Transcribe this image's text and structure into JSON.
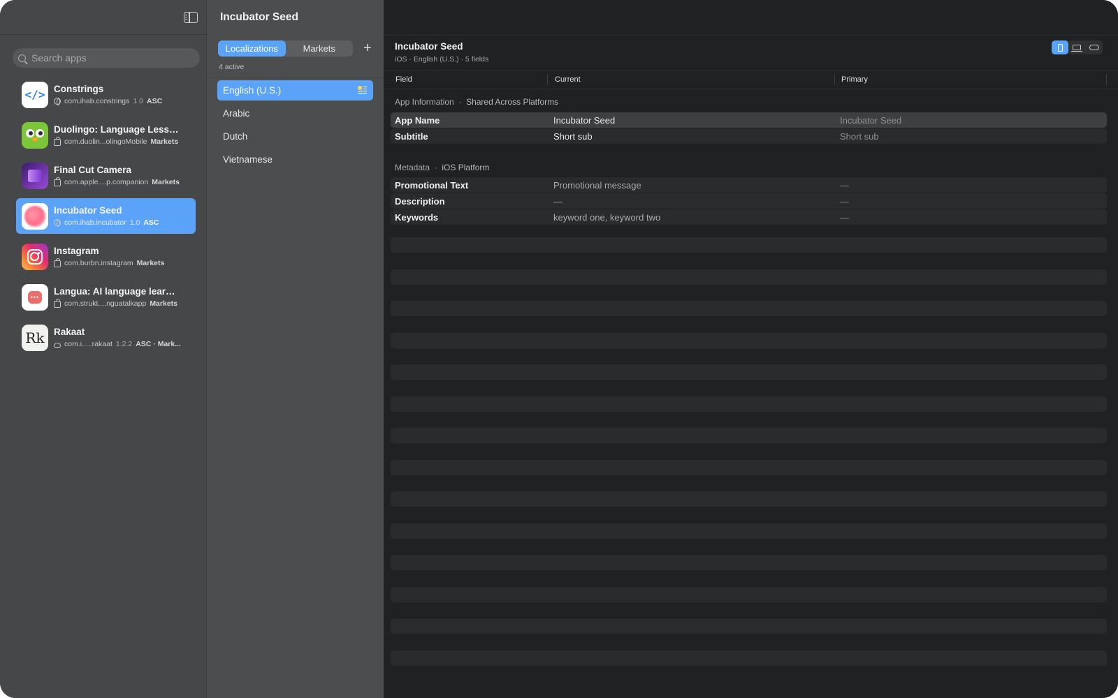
{
  "sidebar": {
    "search_placeholder": "Search apps",
    "apps": [
      {
        "name": "Constrings",
        "bundle": "com.ihab.constrings",
        "version": "1.0",
        "tag": "ASC",
        "meta_icon": "globe-icon",
        "app_icon": "code-brackets-icon"
      },
      {
        "name": "Duolingo: Language Lesso...",
        "bundle": "com.duolin...olingoMobile",
        "version": "",
        "tag": "Markets",
        "meta_icon": "bag-icon",
        "app_icon": "owl-icon"
      },
      {
        "name": "Final Cut Camera",
        "bundle": "com.apple....p.companion",
        "version": "",
        "tag": "Markets",
        "meta_icon": "bag-icon",
        "app_icon": "film-icon"
      },
      {
        "name": "Incubator Seed",
        "bundle": "com.ihab.incubator",
        "version": "1.0",
        "tag": "ASC",
        "meta_icon": "globe-icon",
        "app_icon": "gradient-blob-icon"
      },
      {
        "name": "Instagram",
        "bundle": "com.burbn.instagram",
        "version": "",
        "tag": "Markets",
        "meta_icon": "bag-icon",
        "app_icon": "camera-icon"
      },
      {
        "name": "Langua: AI language learni...",
        "bundle": "com.strukt....nguatalkapp",
        "version": "",
        "tag": "Markets",
        "meta_icon": "bag-icon",
        "app_icon": "chat-bubble-icon"
      },
      {
        "name": "Rakaat",
        "bundle": "com.i.....rakaat",
        "version": "1.2.2",
        "tag": "ASC · Mark...",
        "meta_icon": "cloud-icon",
        "app_icon": "rk-logo-icon"
      }
    ],
    "selected_index": 3
  },
  "middle": {
    "title": "Incubator Seed",
    "tabs": [
      {
        "label": "Localizations",
        "active": true
      },
      {
        "label": "Markets",
        "active": false
      }
    ],
    "plus_label": "+",
    "active_count": "4 active",
    "localizations": [
      {
        "label": "English (U.S.)",
        "selected": true
      },
      {
        "label": "Arabic",
        "selected": false
      },
      {
        "label": "Dutch",
        "selected": false
      },
      {
        "label": "Vietnamese",
        "selected": false
      }
    ]
  },
  "main": {
    "title": "Incubator Seed",
    "subtitle": "iOS · English (U.S.) · 5 fields",
    "platforms": [
      "phone-icon",
      "laptop-icon",
      "vision-pro-icon"
    ],
    "columns": [
      "Field",
      "Current",
      "Primary"
    ],
    "sections": [
      {
        "label": "App Information",
        "sublabel": "Shared Across Platforms",
        "rows": [
          {
            "field": "App Name",
            "current": "Incubator Seed",
            "primary": "Incubator Seed"
          },
          {
            "field": "Subtitle",
            "current": "Short sub",
            "primary": "Short sub"
          }
        ]
      },
      {
        "label": "Metadata",
        "sublabel": "iOS Platform",
        "rows": [
          {
            "field": "Promotional Text",
            "current": "Promotional message",
            "primary": "—"
          },
          {
            "field": "Description",
            "current": "—",
            "primary": "—"
          },
          {
            "field": "Keywords",
            "current": "keyword one, keyword two",
            "primary": "—"
          }
        ]
      }
    ]
  },
  "colors": {
    "accent": "#5aa3f8",
    "sidebar_bg": "#454749",
    "middle_bg": "#4b4d4f",
    "main_bg": "#1f2122"
  }
}
